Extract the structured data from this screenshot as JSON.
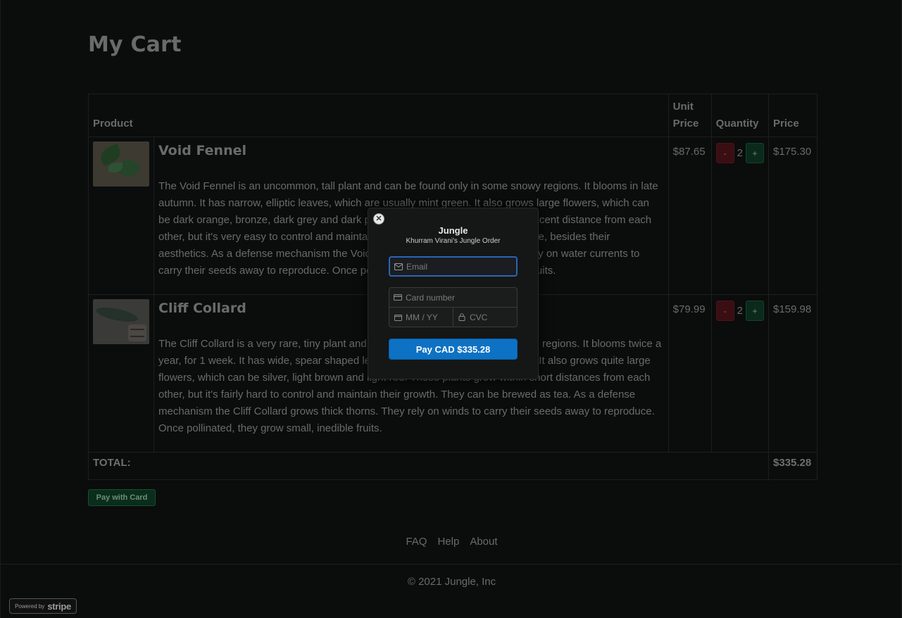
{
  "page": {
    "title": "My Cart"
  },
  "table": {
    "headers": {
      "product": "Product",
      "unit_price": "Unit Price",
      "quantity": "Quantity",
      "price": "Price"
    },
    "rows": [
      {
        "name": "Void Fennel",
        "description": "The Void Fennel is an uncommon, tall plant and can be found only in some snowy regions. It blooms in late autumn. It has narrow, elliptic leaves, which are usually mint green. It also grows large flowers, which can be dark orange, bronze, dark grey and dark purple. These plants grow within a decent distance from each other, but it's very easy to control and maintain their growth. They have no real use, besides their aesthetics. As a defense mechanism the Void Fennel grows thick thorns. They rely on water currents to carry their seeds away to reproduce. Once pollinated, they grow small, inedible fruits.",
        "unit_price": "$87.65",
        "quantity": "2",
        "price": "$175.30",
        "minus_label": "-",
        "plus_label": "+"
      },
      {
        "name": "Cliff Collard",
        "description": "The Cliff Collard is a very rare, tiny plant and can be found only in some mountain regions. It blooms twice a year, for 1 week. It has wide, spear shaped leaves, which are usually dark green. It also grows quite large flowers, which can be silver, light brown and light red. These plants grow within short distances from each other, but it's fairly hard to control and maintain their growth. They can be brewed as tea. As a defense mechanism the Cliff Collard grows thick thorns. They rely on winds to carry their seeds away to reproduce. Once pollinated, they grow small, inedible fruits.",
        "unit_price": "$79.99",
        "quantity": "2",
        "price": "$159.98",
        "minus_label": "-",
        "plus_label": "+"
      }
    ],
    "total_label": "TOTAL:",
    "total_value": "$335.28"
  },
  "actions": {
    "pay_with_card": "Pay with Card"
  },
  "footer": {
    "links": [
      "FAQ",
      "Help",
      "About"
    ],
    "copyright": "© 2021 Jungle, Inc"
  },
  "stripe_badge": {
    "powered_by": "Powered by",
    "wordmark": "stripe"
  },
  "checkout_modal": {
    "close_glyph": "✕",
    "title": "Jungle",
    "subtitle": "Khurram Virani's Jungle Order",
    "email_placeholder": "Email",
    "card_placeholder": "Card number",
    "expiry_placeholder": "MM / YY",
    "cvc_placeholder": "CVC",
    "pay_button": "Pay CAD $335.28"
  },
  "colors": {
    "accent_blue": "#0d72c4",
    "focus_border": "#2b64b5",
    "minus_red": "#3a0e12",
    "plus_green": "#0b2a1c"
  },
  "icons": [
    "close-icon",
    "mail-icon",
    "card-icon",
    "calendar-icon",
    "lock-icon"
  ]
}
